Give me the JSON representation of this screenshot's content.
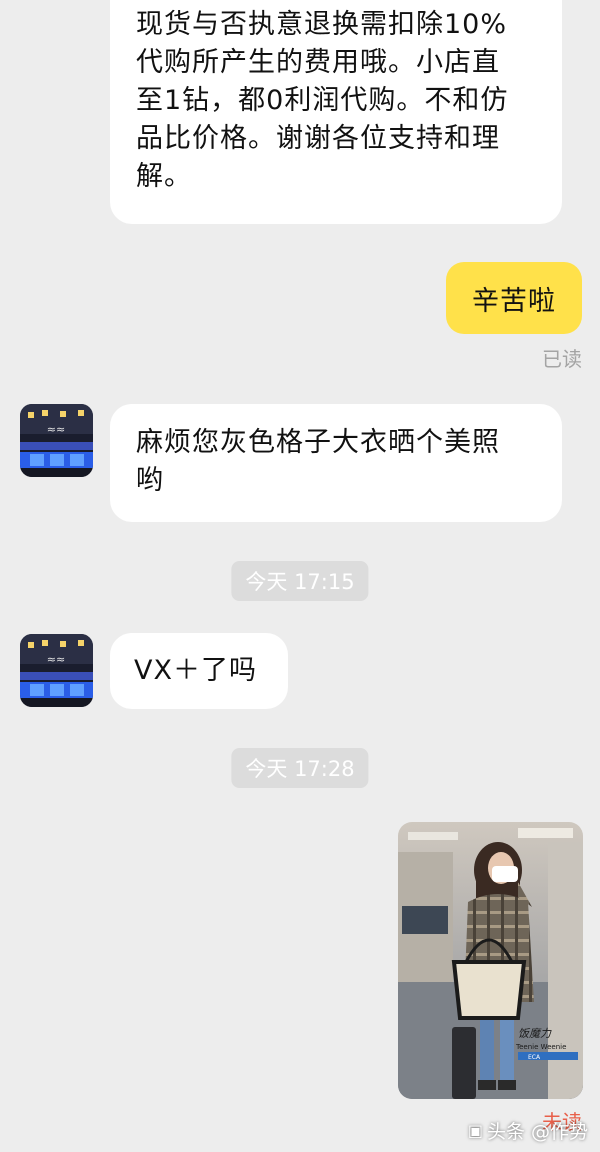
{
  "colors": {
    "background": "#ededed",
    "bubble_incoming": "#ffffff",
    "bubble_outgoing": "#ffe14a",
    "read_status": "#a4a4a4",
    "unread_status": "#e8604a"
  },
  "messages": [
    {
      "sender": "other",
      "lines": [
        "现货与否执意退换需扣除10%",
        "代购所产生的费用哦。小店直",
        "至1钻，都0利润代购。不和仿",
        "品比价格。谢谢各位支持和理",
        "解。"
      ]
    },
    {
      "sender": "me",
      "text": "辛苦啦",
      "status": "已读"
    },
    {
      "sender": "other",
      "lines": [
        "麻烦您灰色格子大衣晒个美照",
        "哟"
      ]
    },
    {
      "sender": "other",
      "text": "VX＋了吗"
    },
    {
      "sender": "me",
      "type": "image",
      "image_caption": "Teenie Weenie",
      "status": "未读"
    }
  ],
  "timestamps": [
    "今天 17:15",
    "今天 17:28"
  ],
  "watermark": {
    "text": "头条 @作势",
    "icon": "toutiao-logo-icon"
  }
}
